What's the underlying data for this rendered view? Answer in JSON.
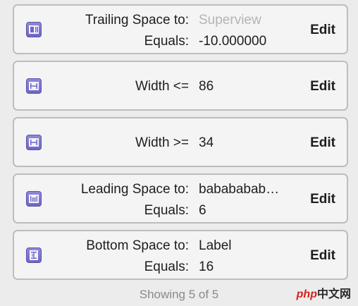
{
  "constraints": [
    {
      "icon": "trailing-space-icon",
      "label": "Trailing Space to:",
      "value": "Superview",
      "value_muted": true,
      "label2": "Equals:",
      "value2": "-10.000000",
      "edit_label": "Edit"
    },
    {
      "icon": "width-icon",
      "label": "Width <=",
      "value": "86",
      "edit_label": "Edit"
    },
    {
      "icon": "width-icon",
      "label": "Width >=",
      "value": "34",
      "edit_label": "Edit"
    },
    {
      "icon": "leading-space-icon",
      "label": "Leading Space to:",
      "value": "babababab…",
      "label2": "Equals:",
      "value2": "6",
      "edit_label": "Edit"
    },
    {
      "icon": "bottom-space-icon",
      "label": "Bottom Space to:",
      "value": "Label",
      "label2": "Equals:",
      "value2": "16",
      "edit_label": "Edit"
    }
  ],
  "footer": {
    "status": "Showing 5 of 5"
  },
  "watermark": {
    "php": "php",
    "site": "中文网"
  },
  "colors": {
    "icon": "#7c74cf",
    "muted": "#b4b4b4"
  }
}
